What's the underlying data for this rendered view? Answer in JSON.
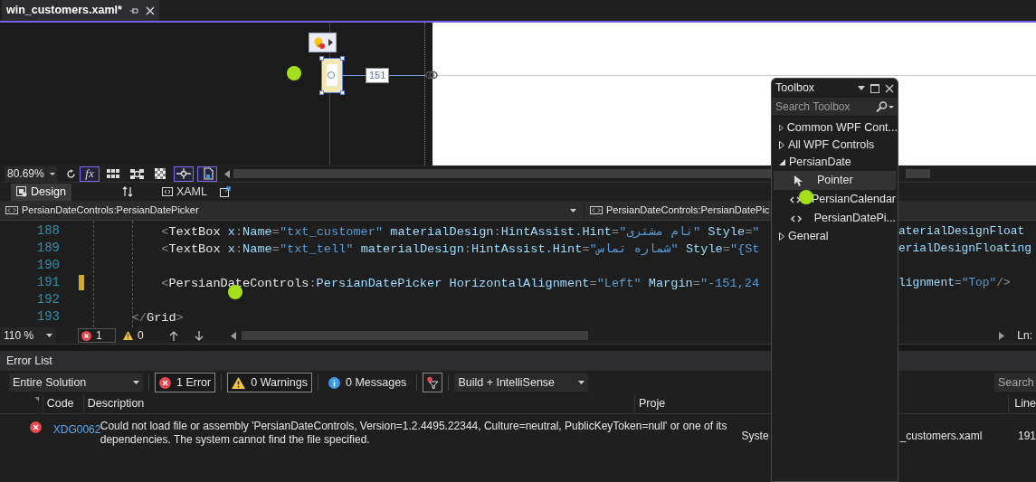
{
  "document_tab": {
    "title": "win_customers.xaml*",
    "selected": true
  },
  "designer": {
    "dimension_label": "151",
    "zoom": "80.69%",
    "toggles": [
      {
        "kind": "formula",
        "label": "fx",
        "on": true
      },
      {
        "kind": "grid",
        "on": false
      },
      {
        "kind": "snap-grid",
        "on": false
      },
      {
        "kind": "checker",
        "on": false
      },
      {
        "kind": "snap-lines",
        "on": true
      },
      {
        "kind": "device",
        "on": true
      }
    ]
  },
  "view_tabs": [
    {
      "label": "Design",
      "selected": true
    },
    {
      "label": "XAML",
      "selected": false
    }
  ],
  "breadcrumbs": [
    "PersianDateControls:PersianDatePicker",
    "PersianDateControls:PersianDatePic"
  ],
  "code_lines": [
    {
      "number": "188",
      "text": "        <TextBox x:Name=\"txt_customer\" materialDesign:HintAssist.Hint=\"نام مشتری\" Style=\"",
      "continuation": "aterialDesignFloat",
      "modified": false
    },
    {
      "number": "189",
      "text": "        <TextBox x:Name=\"txt_tell\" materialDesign:HintAssist.Hint=\"شماره تماس\" Style=\"{St",
      "continuation": "erialDesignFloating",
      "modified": false
    },
    {
      "number": "190",
      "modified": false
    },
    {
      "number": "191",
      "text": "        <PersianDateControls:PersianDatePicker HorizontalAlignment=\"Left\" Margin=\"-151,24",
      "continuation": "lignment=\"Top\"/>",
      "modified": true
    },
    {
      "number": "192",
      "modified": false
    },
    {
      "number": "193",
      "text": "    </Grid>",
      "modified": false
    }
  ],
  "editor_status": {
    "zoom": "110 %",
    "errors": "1",
    "warnings": "0",
    "position": "Ln:"
  },
  "error_list": {
    "title": "Error List",
    "scope": "Entire Solution",
    "filters": [
      {
        "kind": "error",
        "label": "1 Error",
        "selected": true
      },
      {
        "kind": "warning",
        "label": "0 Warnings",
        "selected": true
      },
      {
        "kind": "message",
        "label": "0 Messages",
        "selected": false
      }
    ],
    "source": "Build + IntelliSense",
    "search_placeholder": "Search",
    "columns": [
      "Code",
      "Description",
      "Proje",
      "Line"
    ],
    "rows": [
      {
        "code": "XDG0062",
        "description": "Could not load file or assembly 'PersianDateControls, Version=1.2.4495.22344, Culture=neutral, PublicKeyToken=null' or one of its dependencies. The system cannot find the file specified.",
        "project": "Syste",
        "file": "_customers.xaml",
        "line": "191"
      }
    ]
  },
  "toolbox": {
    "title": "Toolbox",
    "search_placeholder": "Search Toolbox",
    "groups": [
      {
        "label": "Common WPF Cont...",
        "expanded": false
      },
      {
        "label": "All WPF Controls",
        "expanded": false
      },
      {
        "label": "PersianDate",
        "expanded": true,
        "children": [
          {
            "label": "Pointer",
            "kind": "pointer",
            "selected": true
          },
          {
            "label": "PersianCalendar",
            "kind": "control",
            "selected": false
          },
          {
            "label": "PersianDatePi...",
            "kind": "control",
            "selected": false
          }
        ]
      },
      {
        "label": "General",
        "expanded": false
      }
    ]
  }
}
